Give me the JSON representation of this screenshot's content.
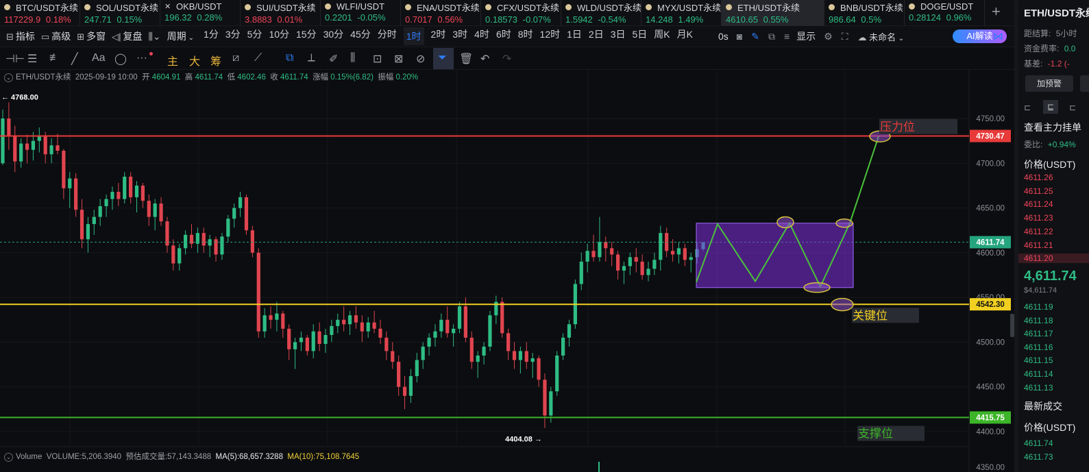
{
  "tickers": [
    {
      "name": "BTC/USDT永续",
      "price": "117229.9",
      "change": "0.18%",
      "dir": "down",
      "mark": "dot"
    },
    {
      "name": "SOL/USDT永续",
      "price": "247.71",
      "change": "0.15%",
      "dir": "up",
      "mark": "dot"
    },
    {
      "name": "OKB/USDT",
      "price": "196.32",
      "change": "0.28%",
      "dir": "up",
      "mark": "x"
    },
    {
      "name": "SUI/USDT永续",
      "price": "3.8883",
      "change": "0.01%",
      "dir": "down",
      "mark": "dot"
    },
    {
      "name": "WLFI/USDT",
      "price": "0.2201",
      "change": "-0.05%",
      "dir": "up",
      "mark": "dot"
    },
    {
      "name": "ENA/USDT永续",
      "price": "0.7017",
      "change": "0.56%",
      "dir": "down",
      "mark": "dot"
    },
    {
      "name": "CFX/USDT永续",
      "price": "0.18573",
      "change": "-0.07%",
      "dir": "up",
      "mark": "dot"
    },
    {
      "name": "WLD/USDT永续",
      "price": "1.5942",
      "change": "-0.54%",
      "dir": "up",
      "mark": "dot"
    },
    {
      "name": "MYX/USDT永续",
      "price": "14.248",
      "change": "1.49%",
      "dir": "up",
      "mark": "dot"
    },
    {
      "name": "ETH/USDT永续",
      "price": "4610.65",
      "change": "0.55%",
      "dir": "up",
      "mark": "dot",
      "active": true
    },
    {
      "name": "BNB/USDT永续",
      "price": "986.64",
      "change": "0.5%",
      "dir": "up",
      "mark": "dot"
    },
    {
      "name": "DOGE/USDT",
      "price": "0.28124",
      "change": "0.96%",
      "dir": "up",
      "mark": "dot"
    }
  ],
  "toolbar": {
    "indicators": "指标",
    "advanced": "高级",
    "multi_window": "多窗",
    "replay": "复盘",
    "period": "周期",
    "timeframes": [
      "1分",
      "3分",
      "5分",
      "10分",
      "15分",
      "30分",
      "45分",
      "分时",
      "1时",
      "2时",
      "3时",
      "4时",
      "6时",
      "8时",
      "12时",
      "1日",
      "2日",
      "3日",
      "5日",
      "周K",
      "月K"
    ],
    "active_timeframe": "1时",
    "countdown": "0s",
    "display": "显示",
    "layout_name": "未命名",
    "ai_button": "AI解读"
  },
  "draw_tools": {
    "main": "主",
    "big": "大",
    "chips": "筹"
  },
  "ohlc": {
    "symbol": "ETH/USDT永续",
    "datetime": "2025-09-19 10:00",
    "open_label": "开",
    "open": "4604.91",
    "high_label": "高",
    "high": "4611.74",
    "low_label": "低",
    "low": "4602.46",
    "close_label": "收",
    "close": "4611.74",
    "change_label": "涨幅",
    "change": "0.15%(6.82)",
    "amp_label": "振幅",
    "amp": "0.20%"
  },
  "volume": {
    "label": "Volume",
    "volume_text": "VOLUME:5,206.3940",
    "est_label": "预估成交量:57,143.3488",
    "ma5": "MA(5):68,657.3288",
    "ma10": "MA(10):75,108.7645"
  },
  "chart_data": {
    "type": "candlestick",
    "y_ticks": [
      "4750.00",
      "4700.00",
      "4650.00",
      "4600.00",
      "4550.00",
      "4500.00",
      "4450.00",
      "4400.00"
    ],
    "y_range": [
      4385,
      4790
    ],
    "candles": [
      [
        4700,
        4760,
        4698,
        4750
      ],
      [
        4750,
        4768,
        4715,
        4730
      ],
      [
        4730,
        4742,
        4690,
        4702
      ],
      [
        4702,
        4728,
        4695,
        4722
      ],
      [
        4722,
        4732,
        4700,
        4715
      ],
      [
        4715,
        4735,
        4703,
        4725
      ],
      [
        4725,
        4740,
        4712,
        4730
      ],
      [
        4730,
        4735,
        4700,
        4710
      ],
      [
        4710,
        4728,
        4700,
        4720
      ],
      [
        4720,
        4733,
        4710,
        4714
      ],
      [
        4714,
        4716,
        4660,
        4672
      ],
      [
        4672,
        4690,
        4650,
        4683
      ],
      [
        4683,
        4689,
        4640,
        4648
      ],
      [
        4648,
        4660,
        4605,
        4615
      ],
      [
        4615,
        4640,
        4600,
        4632
      ],
      [
        4632,
        4648,
        4620,
        4640
      ],
      [
        4640,
        4660,
        4630,
        4652
      ],
      [
        4652,
        4665,
        4640,
        4660
      ],
      [
        4660,
        4674,
        4648,
        4668
      ],
      [
        4668,
        4678,
        4652,
        4660
      ],
      [
        4660,
        4690,
        4655,
        4685
      ],
      [
        4685,
        4690,
        4655,
        4662
      ],
      [
        4662,
        4680,
        4645,
        4675
      ],
      [
        4675,
        4678,
        4650,
        4658
      ],
      [
        4658,
        4665,
        4630,
        4640
      ],
      [
        4640,
        4660,
        4625,
        4655
      ],
      [
        4655,
        4662,
        4630,
        4635
      ],
      [
        4635,
        4640,
        4600,
        4608
      ],
      [
        4608,
        4615,
        4580,
        4588
      ],
      [
        4588,
        4610,
        4580,
        4605
      ],
      [
        4605,
        4625,
        4598,
        4620
      ],
      [
        4620,
        4632,
        4605,
        4610
      ],
      [
        4610,
        4628,
        4600,
        4622
      ],
      [
        4622,
        4628,
        4600,
        4608
      ],
      [
        4608,
        4620,
        4595,
        4615
      ],
      [
        4615,
        4618,
        4590,
        4598
      ],
      [
        4598,
        4622,
        4592,
        4618
      ],
      [
        4618,
        4642,
        4612,
        4638
      ],
      [
        4638,
        4655,
        4628,
        4650
      ],
      [
        4650,
        4668,
        4640,
        4662
      ],
      [
        4662,
        4665,
        4620,
        4625
      ],
      [
        4625,
        4630,
        4595,
        4600
      ],
      [
        4600,
        4605,
        4505,
        4512
      ],
      [
        4512,
        4538,
        4505,
        4530
      ],
      [
        4530,
        4540,
        4515,
        4525
      ],
      [
        4525,
        4545,
        4512,
        4532
      ],
      [
        4532,
        4535,
        4505,
        4515
      ],
      [
        4515,
        4520,
        4480,
        4492
      ],
      [
        4492,
        4505,
        4470,
        4500
      ],
      [
        4500,
        4512,
        4490,
        4505
      ],
      [
        4505,
        4508,
        4485,
        4490
      ],
      [
        4490,
        4520,
        4482,
        4512
      ],
      [
        4512,
        4522,
        4490,
        4498
      ],
      [
        4498,
        4515,
        4488,
        4508
      ],
      [
        4508,
        4525,
        4500,
        4518
      ],
      [
        4518,
        4532,
        4510,
        4525
      ],
      [
        4525,
        4540,
        4512,
        4520
      ],
      [
        4520,
        4535,
        4508,
        4530
      ],
      [
        4530,
        4540,
        4515,
        4522
      ],
      [
        4522,
        4530,
        4500,
        4512
      ],
      [
        4512,
        4528,
        4505,
        4522
      ],
      [
        4522,
        4535,
        4510,
        4515
      ],
      [
        4515,
        4525,
        4498,
        4505
      ],
      [
        4505,
        4512,
        4480,
        4490
      ],
      [
        4490,
        4500,
        4470,
        4478
      ],
      [
        4478,
        4485,
        4440,
        4450
      ],
      [
        4450,
        4462,
        4425,
        4440
      ],
      [
        4440,
        4470,
        4432,
        4462
      ],
      [
        4462,
        4488,
        4455,
        4480
      ],
      [
        4480,
        4500,
        4470,
        4495
      ],
      [
        4495,
        4510,
        4485,
        4505
      ],
      [
        4505,
        4520,
        4495,
        4512
      ],
      [
        4512,
        4532,
        4505,
        4525
      ],
      [
        4525,
        4540,
        4505,
        4510
      ],
      [
        4510,
        4520,
        4495,
        4515
      ],
      [
        4515,
        4545,
        4510,
        4540
      ],
      [
        4540,
        4550,
        4500,
        4505
      ],
      [
        4505,
        4512,
        4470,
        4478
      ],
      [
        4478,
        4490,
        4460,
        4485
      ],
      [
        4485,
        4500,
        4475,
        4495
      ],
      [
        4495,
        4535,
        4490,
        4530
      ],
      [
        4530,
        4552,
        4520,
        4545
      ],
      [
        4545,
        4550,
        4505,
        4510
      ],
      [
        4510,
        4515,
        4480,
        4490
      ],
      [
        4490,
        4500,
        4470,
        4480
      ],
      [
        4480,
        4495,
        4465,
        4490
      ],
      [
        4490,
        4500,
        4470,
        4478
      ],
      [
        4478,
        4488,
        4460,
        4482
      ],
      [
        4482,
        4485,
        4450,
        4458
      ],
      [
        4458,
        4465,
        4404,
        4418
      ],
      [
        4418,
        4450,
        4410,
        4445
      ],
      [
        4445,
        4490,
        4440,
        4485
      ],
      [
        4485,
        4510,
        4480,
        4505
      ],
      [
        4505,
        4525,
        4495,
        4520
      ],
      [
        4520,
        4570,
        4515,
        4565
      ],
      [
        4565,
        4600,
        4558,
        4590
      ],
      [
        4590,
        4610,
        4578,
        4602
      ],
      [
        4602,
        4620,
        4590,
        4595
      ],
      [
        4595,
        4640,
        4590,
        4612
      ],
      [
        4612,
        4618,
        4590,
        4605
      ],
      [
        4605,
        4612,
        4585,
        4598
      ],
      [
        4598,
        4602,
        4570,
        4580
      ],
      [
        4580,
        4590,
        4565,
        4585
      ],
      [
        4585,
        4600,
        4575,
        4595
      ],
      [
        4595,
        4605,
        4578,
        4590
      ],
      [
        4590,
        4598,
        4570,
        4575
      ],
      [
        4575,
        4590,
        4568,
        4582
      ],
      [
        4582,
        4600,
        4575,
        4592
      ],
      [
        4592,
        4630,
        4580,
        4622
      ],
      [
        4622,
        4628,
        4595,
        4602
      ],
      [
        4602,
        4615,
        4590,
        4598
      ],
      [
        4598,
        4612,
        4588,
        4605
      ],
      [
        4605,
        4610,
        4585,
        4592
      ],
      [
        4592,
        4600,
        4578,
        4595
      ],
      [
        4595,
        4612,
        4588,
        4604
      ],
      [
        4604,
        4612,
        4602,
        4611.74
      ]
    ],
    "high_marker": "4768.00",
    "low_marker": "4404.08",
    "levels": [
      {
        "price": 4730.47,
        "label": "4730.47",
        "color": "#e83a3a",
        "name": "压力位"
      },
      {
        "price": 4542.3,
        "label": "4542.30",
        "color": "#f2d021",
        "name": "关键位"
      },
      {
        "price": 4415.75,
        "label": "4415.75",
        "color": "#3cb528",
        "name": "支撑位"
      }
    ],
    "current_price": {
      "price": 4611.74,
      "label": "4611.74",
      "color": "#25a57d"
    },
    "partial_tick": "4350.00"
  },
  "right_panel": {
    "title": "ETH/USDT永续",
    "settle_label": "距结算",
    "settle_val": "5小时",
    "funding_label": "资金费率",
    "funding_val": "0.0",
    "basis_label": "基差",
    "basis_val": "-1.2 (-",
    "alert_btn": "加预警",
    "depth_title": "查看主力挂单",
    "ratio_label": "委比",
    "ratio_val": "+0.94%",
    "price_header": "价格(USDT)",
    "asks": [
      "4611.26",
      "4611.25",
      "4611.24",
      "4611.23",
      "4611.22",
      "4611.21",
      "4611.20"
    ],
    "last_price": "4,611.74",
    "last_price_usd": "$4,611.74",
    "bids": [
      "4611.19",
      "4611.18",
      "4611.17",
      "4611.16",
      "4611.15",
      "4611.14",
      "4611.13"
    ],
    "trades_title": "最新成交",
    "trades_header": "价格(USDT)",
    "trades": [
      "4611.74",
      "4611.73"
    ]
  }
}
